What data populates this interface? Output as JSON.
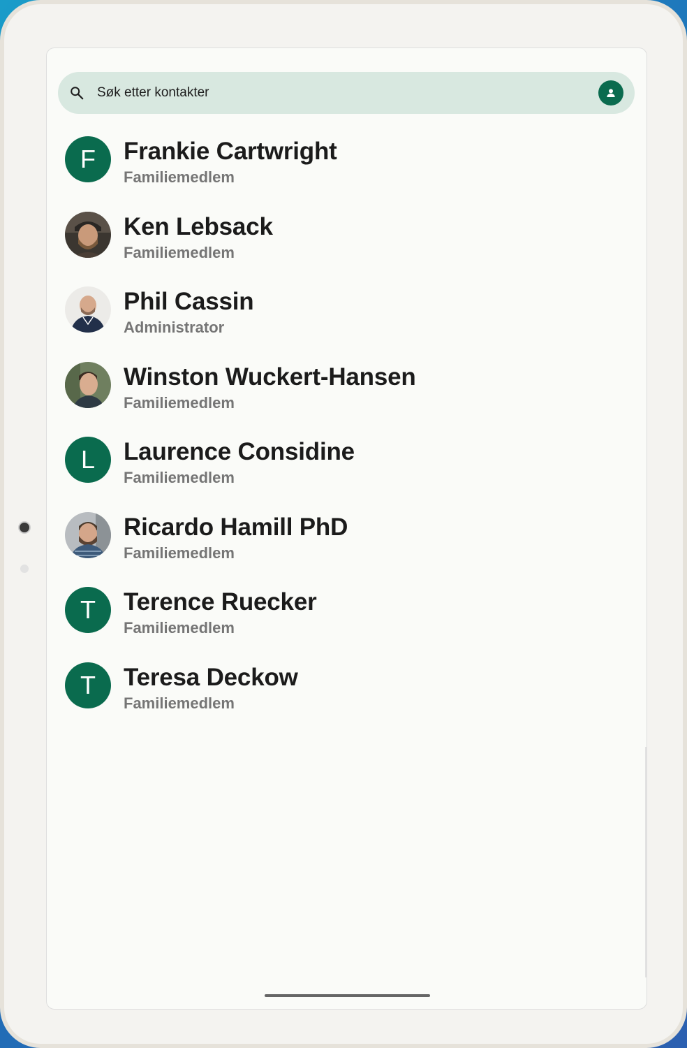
{
  "search": {
    "placeholder": "Søk etter kontakter",
    "value": ""
  },
  "contacts": [
    {
      "name": "Frankie Cartwright",
      "role": "Familiemedlem",
      "avatar": {
        "type": "letter",
        "letter": "F"
      }
    },
    {
      "name": "Ken Lebsack",
      "role": "Familiemedlem",
      "avatar": {
        "type": "photo",
        "description": "bearded man in cap"
      }
    },
    {
      "name": "Phil Cassin",
      "role": "Administrator",
      "avatar": {
        "type": "photo",
        "description": "bald man in dark hoodie"
      }
    },
    {
      "name": "Winston Wuckert-Hansen",
      "role": "Familiemedlem",
      "avatar": {
        "type": "photo",
        "description": "young man outdoors"
      }
    },
    {
      "name": "Laurence Considine",
      "role": "Familiemedlem",
      "avatar": {
        "type": "letter",
        "letter": "L"
      }
    },
    {
      "name": "Ricardo Hamill PhD",
      "role": "Familiemedlem",
      "avatar": {
        "type": "photo",
        "description": "bearded man in plaid shirt"
      }
    },
    {
      "name": "Terence Ruecker",
      "role": "Familiemedlem",
      "avatar": {
        "type": "letter",
        "letter": "T"
      }
    },
    {
      "name": "Teresa Deckow",
      "role": "Familiemedlem",
      "avatar": {
        "type": "letter",
        "letter": "T"
      }
    }
  ],
  "icons": {
    "search": "search-icon",
    "account": "account-icon"
  },
  "colors": {
    "accent": "#0a6b4e",
    "search_bar_bg": "#d8e8e0",
    "screen_bg": "#fafbf8",
    "secondary_text": "#757575"
  }
}
